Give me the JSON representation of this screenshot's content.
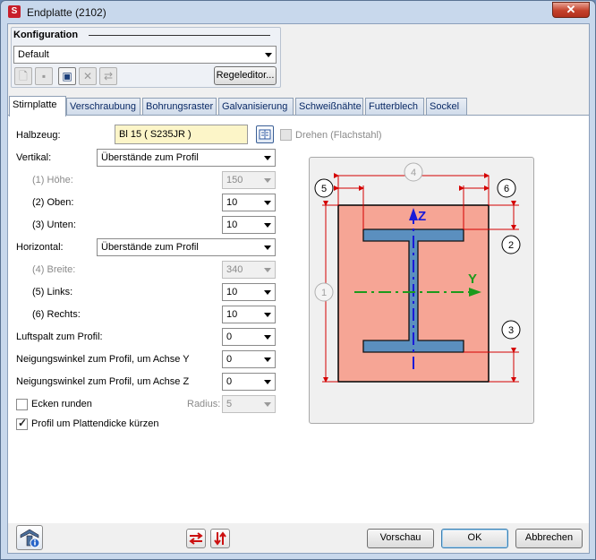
{
  "window": {
    "title": "Endplatte (2102)",
    "app_icon": "hicad-logo-icon",
    "close_label": "✕"
  },
  "config": {
    "title": "Konfiguration",
    "selected": "Default",
    "toolbar_icons": [
      "new-config-icon",
      "save-config-icon",
      "save-as-config-icon",
      "delete-config-icon",
      "refresh-config-icon"
    ],
    "editor_label": "Regeleditor..."
  },
  "tabs": [
    "Stirnplatte",
    "Verschraubung",
    "Bohrungsraster",
    "Galvanisierung",
    "Schweißnähte",
    "Futterblech",
    "Sockel"
  ],
  "active_tab": "Stirnplatte",
  "form": {
    "halbzeug_label": "Halbzeug:",
    "halbzeug_value": "Bl 15  ( S235JR )",
    "drehen_label": "Drehen (Flachstahl)",
    "vertikal_label": "Vertikal:",
    "vertikal_value": "Überstände zum Profil",
    "hoehe_label": "(1) Höhe:",
    "hoehe_value": "150",
    "oben_label": "(2) Oben:",
    "oben_value": "10",
    "unten_label": "(3) Unten:",
    "unten_value": "10",
    "horizontal_label": "Horizontal:",
    "horizontal_value": "Überstände zum Profil",
    "breite_label": "(4) Breite:",
    "breite_value": "340",
    "links_label": "(5) Links:",
    "links_value": "10",
    "rechts_label": "(6) Rechts:",
    "rechts_value": "10",
    "luftspalt_label": "Luftspalt zum Profil:",
    "luftspalt_value": "0",
    "neigung_y_label": "Neigungswinkel zum Profil, um Achse Y",
    "neigung_y_value": "0",
    "neigung_z_label": "Neigungswinkel zum Profil, um Achse Z",
    "neigung_z_value": "0",
    "ecken_label": "Ecken runden",
    "ecken_checked": false,
    "radius_label": "Radius:",
    "radius_value": "5",
    "kuerzen_label": "Profil um Plattendicke kürzen",
    "kuerzen_checked": true
  },
  "figure": {
    "axis_z": "Z",
    "axis_y": "Y",
    "markers": [
      "1",
      "2",
      "3",
      "4",
      "5",
      "6"
    ],
    "colors": {
      "plate": "#f6a595",
      "profile": "#5b8fbf",
      "dim": "#d40000",
      "z_axis": "#1a1ad8",
      "y_axis": "#1c9a1c"
    }
  },
  "footer": {
    "info_icon": "profile-info-icon",
    "swap_h_icon": "swap-horizontal-icon",
    "swap_v_icon": "swap-vertical-icon",
    "preview_label": "Vorschau",
    "ok_label": "OK",
    "cancel_label": "Abbrechen"
  }
}
